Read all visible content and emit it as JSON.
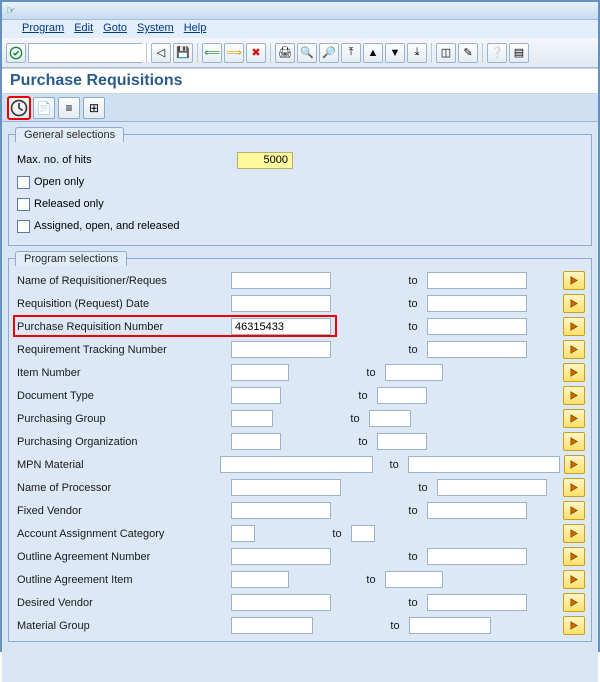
{
  "menubar": [
    "Program",
    "Edit",
    "Goto",
    "System",
    "Help"
  ],
  "page_title": "Purchase Requisitions",
  "general": {
    "title": "General selections",
    "max_hits_label": "Max. no. of hits",
    "max_hits_value": "5000",
    "open_only": "Open only",
    "released_only": "Released only",
    "assigned_open_released": "Assigned, open, and released"
  },
  "program": {
    "title": "Program selections",
    "to_label": "to",
    "rows": [
      {
        "label": "Name of Requisitioner/Reques",
        "from": "",
        "to": "",
        "w_from": 100,
        "w_to": 100
      },
      {
        "label": "Requisition (Request) Date",
        "from": "",
        "to": "",
        "w_from": 100,
        "w_to": 100
      },
      {
        "label": "Purchase Requisition Number",
        "from": "46315433",
        "to": "",
        "w_from": 100,
        "w_to": 100,
        "hl": true
      },
      {
        "label": "Requirement Tracking Number",
        "from": "",
        "to": "",
        "w_from": 100,
        "w_to": 100
      },
      {
        "label": "Item Number",
        "from": "",
        "to": "",
        "w_from": 58,
        "w_to": 58
      },
      {
        "label": "Document Type",
        "from": "",
        "to": "",
        "w_from": 50,
        "w_to": 50
      },
      {
        "label": "Purchasing Group",
        "from": "",
        "to": "",
        "w_from": 42,
        "w_to": 42
      },
      {
        "label": "Purchasing Organization",
        "from": "",
        "to": "",
        "w_from": 50,
        "w_to": 50
      },
      {
        "label": "MPN Material",
        "from": "",
        "to": "",
        "w_from": 160,
        "w_to": 160,
        "wide": true
      },
      {
        "label": "Name of Processor",
        "from": "",
        "to": "",
        "w_from": 110,
        "w_to": 110
      },
      {
        "label": "Fixed Vendor",
        "from": "",
        "to": "",
        "w_from": 100,
        "w_to": 100
      },
      {
        "label": "Account Assignment Category",
        "from": "",
        "to": "",
        "w_from": 24,
        "w_to": 24
      },
      {
        "label": "Outline Agreement Number",
        "from": "",
        "to": "",
        "w_from": 100,
        "w_to": 100
      },
      {
        "label": "Outline Agreement Item",
        "from": "",
        "to": "",
        "w_from": 58,
        "w_to": 58
      },
      {
        "label": "Desired Vendor",
        "from": "",
        "to": "",
        "w_from": 100,
        "w_to": 100
      },
      {
        "label": "Material Group",
        "from": "",
        "to": "",
        "w_from": 82,
        "w_to": 82
      }
    ]
  }
}
